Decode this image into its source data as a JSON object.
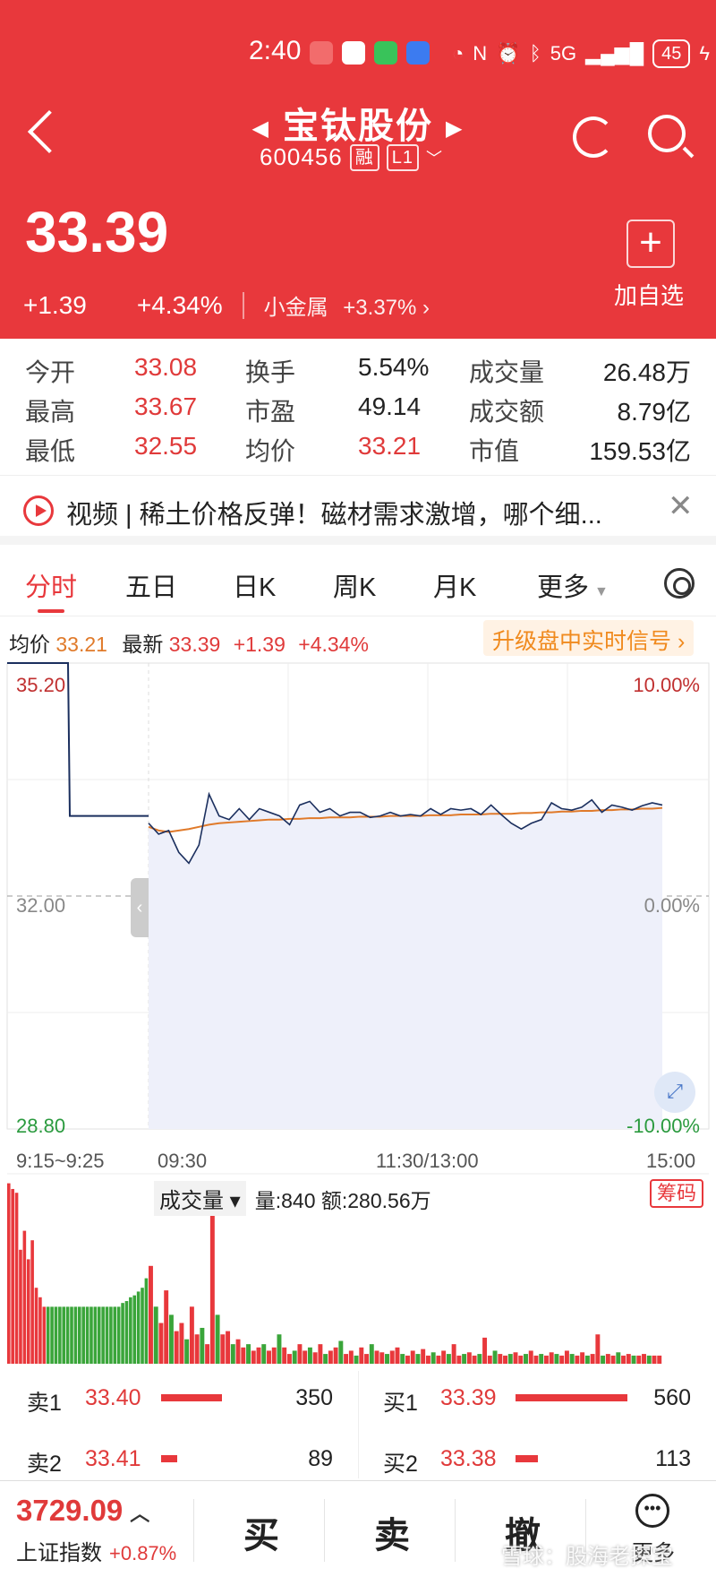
{
  "status_bar": {
    "time": "2:40",
    "network": "5G",
    "battery": "45"
  },
  "header": {
    "title": "宝钛股份",
    "code": "600456",
    "tag_margin": "融",
    "tag_level": "L1",
    "price": "33.39",
    "change": "+1.39",
    "change_pct": "+4.34%",
    "sector_name": "小金属",
    "sector_pct": "+3.37%",
    "add_watch_label": "加自选",
    "bg_color": "#e8383c"
  },
  "quote": [
    {
      "label": "今开",
      "value": "33.08"
    },
    {
      "label": "换手",
      "value": "5.54%"
    },
    {
      "label": "成交量",
      "value": "26.48万"
    },
    {
      "label": "最高",
      "value": "33.67"
    },
    {
      "label": "市盈",
      "value": "49.14"
    },
    {
      "label": "成交额",
      "value": "8.79亿"
    },
    {
      "label": "最低",
      "value": "32.55"
    },
    {
      "label": "均价",
      "value": "33.21"
    },
    {
      "label": "市值",
      "value": "159.53亿"
    }
  ],
  "news": {
    "text": "视频 | 稀土价格反弹！磁材需求激增，哪个细..."
  },
  "tabs": [
    "分时",
    "五日",
    "日K",
    "周K",
    "月K",
    "更多"
  ],
  "info_line": {
    "avg_label": "均价",
    "avg_value": "33.21",
    "last_label": "最新",
    "last_value": "33.39",
    "change": "+1.39",
    "change_pct": "+4.34%",
    "signal_label": "升级盘中实时信号 ›"
  },
  "chart_data": {
    "type": "line",
    "y_left_ticks": [
      "35.20",
      "32.00",
      "28.80"
    ],
    "y_right_ticks": [
      "10.00%",
      "0.00%",
      "-10.00%"
    ],
    "x_ticks": [
      "9:15~9:25",
      "09:30",
      "11:30/13:00",
      "15:00"
    ],
    "ylim": [
      28.8,
      35.2
    ],
    "prev_close": 32.0,
    "pre_market": [
      35.2,
      35.2,
      33.1,
      33.1,
      33.1
    ],
    "price": [
      33.0,
      32.85,
      32.9,
      32.6,
      32.45,
      32.7,
      33.4,
      33.1,
      33.05,
      33.2,
      33.05,
      33.2,
      33.15,
      33.1,
      32.98,
      33.25,
      33.3,
      33.15,
      33.2,
      33.1,
      33.15,
      33.15,
      33.08,
      33.1,
      33.15,
      33.1,
      33.12,
      33.1,
      33.2,
      33.12,
      33.2,
      33.18,
      33.2,
      33.12,
      33.25,
      33.12,
      33.0,
      32.92,
      33.0,
      33.05,
      33.28,
      33.2,
      33.18,
      33.22,
      33.32,
      33.15,
      33.25,
      33.22,
      33.18,
      33.24,
      33.28,
      33.25
    ],
    "avg": [
      32.95,
      32.9,
      32.88,
      32.9,
      32.92,
      32.95,
      32.98,
      33.0,
      33.01,
      33.02,
      33.03,
      33.04,
      33.05,
      33.05,
      33.06,
      33.06,
      33.07,
      33.07,
      33.08,
      33.08,
      33.08,
      33.09,
      33.09,
      33.09,
      33.1,
      33.1,
      33.1,
      33.1,
      33.11,
      33.11,
      33.11,
      33.12,
      33.12,
      33.12,
      33.13,
      33.13,
      33.13,
      33.14,
      33.14,
      33.15,
      33.15,
      33.16,
      33.16,
      33.17,
      33.17,
      33.18,
      33.18,
      33.19,
      33.19,
      33.2,
      33.2,
      33.21
    ],
    "series": [
      {
        "name": "均价"
      },
      {
        "name": "最新"
      }
    ]
  },
  "volume": {
    "label": "成交量 ▾",
    "info": "量:840 额:280.56万",
    "chips_label": "筹码",
    "pre_bars": [
      0.95,
      0.92,
      0.9,
      0.6,
      0.7,
      0.55,
      0.65,
      0.4,
      0.35,
      0.3,
      0.3,
      0.3,
      0.3,
      0.3,
      0.3,
      0.3,
      0.3,
      0.3,
      0.3,
      0.3,
      0.3,
      0.3,
      0.3,
      0.3,
      0.3,
      0.3,
      0.3,
      0.3,
      0.3,
      0.32,
      0.33,
      0.35,
      0.36,
      0.38,
      0.4,
      0.45
    ],
    "bars": [
      0.6,
      0.35,
      0.25,
      0.45,
      0.3,
      0.2,
      0.25,
      0.15,
      0.35,
      0.18,
      0.22,
      0.12,
      0.95,
      0.3,
      0.18,
      0.2,
      0.12,
      0.15,
      0.1,
      0.12,
      0.08,
      0.1,
      0.12,
      0.08,
      0.1,
      0.18,
      0.1,
      0.06,
      0.08,
      0.12,
      0.08,
      0.1,
      0.07,
      0.12,
      0.06,
      0.08,
      0.1,
      0.14,
      0.06,
      0.08,
      0.05,
      0.1,
      0.06,
      0.12,
      0.08,
      0.07,
      0.06,
      0.08,
      0.1,
      0.06,
      0.05,
      0.08,
      0.06,
      0.09,
      0.05,
      0.07,
      0.05,
      0.08,
      0.06,
      0.12,
      0.05,
      0.06,
      0.07,
      0.05,
      0.06,
      0.16,
      0.05,
      0.08,
      0.06,
      0.05,
      0.06,
      0.07,
      0.05,
      0.06,
      0.08,
      0.05,
      0.06,
      0.05,
      0.07,
      0.06,
      0.05,
      0.08,
      0.06,
      0.05,
      0.07,
      0.05,
      0.06,
      0.18,
      0.05,
      0.06,
      0.05,
      0.07,
      0.05,
      0.06,
      0.05,
      0.05,
      0.06,
      0.05,
      0.05,
      0.05
    ]
  },
  "order_book": {
    "sell": [
      {
        "label": "卖1",
        "price": "33.40",
        "qty": "350",
        "ratio": 0.62
      },
      {
        "label": "卖2",
        "price": "33.41",
        "qty": "89",
        "ratio": 0.16
      }
    ],
    "buy": [
      {
        "label": "买1",
        "price": "33.39",
        "qty": "560",
        "ratio": 1.0
      },
      {
        "label": "买2",
        "price": "33.38",
        "qty": "113",
        "ratio": 0.2
      }
    ]
  },
  "bottom_bar": {
    "index_value": "3729.09",
    "index_name": "上证指数",
    "index_pct": "+0.87%",
    "buy": "买",
    "sell": "卖",
    "cancel": "撤",
    "more": "更多",
    "watermark": "雪球：股海老探宝"
  }
}
